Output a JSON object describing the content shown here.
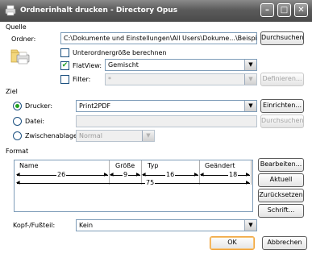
{
  "window": {
    "title": "Ordnerinhalt drucken - Directory Opus",
    "minimize_glyph": "–",
    "maximize_glyph": "□",
    "close_glyph": "✕"
  },
  "quelle": {
    "label": "Quelle",
    "ordner_label": "Ordner:",
    "ordner_value": "C:\\Dokumente und Einstellungen\\All Users\\Dokume...\\Beispielbilder",
    "durchsuchen": "Durchsuchen",
    "unterordner_label": "Unterordnergröße berechnen",
    "unterordner_checked": false,
    "flatview_label": "FlatView:",
    "flatview_checked": true,
    "flatview_value": "Gemischt",
    "filter_label": "Filter:",
    "filter_checked": false,
    "filter_value": "*",
    "definieren": "Definieren..."
  },
  "ziel": {
    "label": "Ziel",
    "drucker_label": "Drucker:",
    "drucker_selected": true,
    "drucker_value": "Print2PDF",
    "einrichten": "Einrichten...",
    "datei_label": "Datei:",
    "datei_selected": false,
    "datei_value": "",
    "durchsuchen": "Durchsuchen",
    "zwischenablage_label": "Zwischenablage:",
    "zwischenablage_selected": false,
    "zwischenablage_value": "Normal"
  },
  "format": {
    "label": "Format",
    "columns": [
      {
        "name": "Name",
        "width": "26"
      },
      {
        "name": "Größe",
        "width": "9"
      },
      {
        "name": "Typ",
        "width": "16"
      },
      {
        "name": "Geändert",
        "width": "18"
      }
    ],
    "total_width": "75",
    "bearbeiten": "Bearbeiten...",
    "aktuell": "Aktuell",
    "zuruecksetzen": "Zurücksetzen",
    "schrift": "Schrift...",
    "kopf_label": "Kopf-/Fußteil:",
    "kopf_value": "Kein"
  },
  "footer": {
    "ok": "OK",
    "abbrechen": "Abbrechen"
  },
  "colors": {
    "titlebar": "#5b5b5b",
    "check_green": "#21a121",
    "field_border": "#7f9db9",
    "default_button_border": "#f0a43c"
  }
}
